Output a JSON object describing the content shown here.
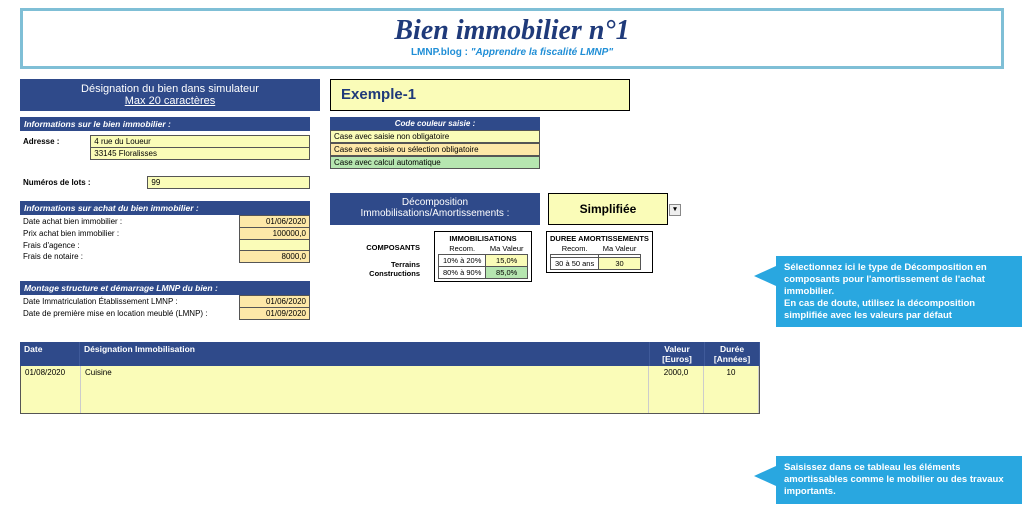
{
  "header": {
    "title": "Bien immobilier n°1",
    "subtitle_site": "LMNP.blog",
    "subtitle_colon": " : ",
    "subtitle_quote": "\"Apprendre la fiscalité LMNP\""
  },
  "designation": {
    "label_line1": "Désignation du bien dans simulateur",
    "label_line2": "Max 20 caractères",
    "value": "Exemple-1"
  },
  "sections": {
    "info_bien": "Informations sur le bien immobilier :",
    "info_achat": "Informations sur achat du bien immobilier :",
    "montage": "Montage structure et démarrage LMNP du bien :"
  },
  "adresse": {
    "label": "Adresse :",
    "line1": "4 rue du Loueur",
    "line2": "33145 Floralisses"
  },
  "lots": {
    "label": "Numéros de lots :",
    "value": "99"
  },
  "achat": {
    "r1l": "Date achat bien immobilier :",
    "r1v": "01/06/2020",
    "r2l": "Prix achat bien immobilier :",
    "r2v": "100000,0",
    "r3l": "Frais d'agence :",
    "r3v": "",
    "r4l": "Frais de notaire :",
    "r4v": "8000,0"
  },
  "montage": {
    "r1l": "Date Immatriculation Établissement LMNP :",
    "r1v": "01/06/2020",
    "r2l": "Date de première mise en location meublé (LMNP) :",
    "r2v": "01/09/2020"
  },
  "code": {
    "header": "Code couleur saisie :",
    "r1": "Case avec saisie non obligatoire",
    "r2": "Case avec saisie ou sélection obligatoire",
    "r3": "Case avec calcul automatique"
  },
  "decomp": {
    "label_l1": "Décomposition",
    "label_l2": "Immobilisations/Amortissements :",
    "value": "Simplifiée"
  },
  "comp": {
    "hdr": "COMPOSANTS",
    "immob_hdr": "IMMOBILISATIONS",
    "duree_hdr": "DUREE AMORTISSEMENTS",
    "col_rec": "Recom.",
    "col_mv": "Ma Valeur",
    "row1": "Terrains",
    "row2": "Constructions",
    "t_rec": "10% à 20%",
    "t_mv": "15,0%",
    "c_rec": "80% à 90%",
    "c_mv": "85,0%",
    "d_rec": "30 à 50 ans",
    "d_mv": "30"
  },
  "btable": {
    "h_date": "Date",
    "h_des": "Désignation Immobilisation",
    "h_val_l1": "Valeur",
    "h_val_l2": "[Euros]",
    "h_dur_l1": "Durée",
    "h_dur_l2": "[Années]",
    "r1_date": "01/08/2020",
    "r1_des": "Cuisine",
    "r1_val": "2000,0",
    "r1_dur": "10"
  },
  "callouts": {
    "c1": "Sélectionnez ici le type de Décomposition en composants pour l'amortissement de l'achat immobilier.\nEn cas de doute, utilisez la décomposition simplifiée avec les valeurs par défaut",
    "c2": "Saisissez dans ce tableau les éléments amortissables comme le mobilier ou des travaux importants."
  }
}
